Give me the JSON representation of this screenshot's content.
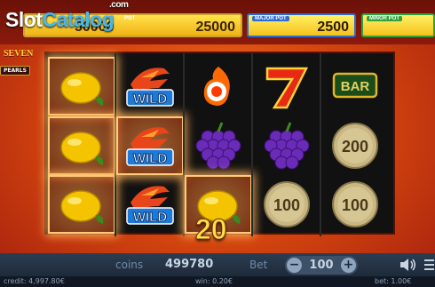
{
  "watermark": {
    "part_a": "Slot",
    "part_b": "Catalog",
    "com": ".com"
  },
  "jackpots": {
    "grand": {
      "label": "POT",
      "value": "50000"
    },
    "second": {
      "label": "POT",
      "value": "25000"
    },
    "major": {
      "label": "MAJOR POT",
      "value": "2500"
    },
    "minor": {
      "label": "MINOR POT",
      "value": ""
    }
  },
  "logo": {
    "title": "SEVEN",
    "subtitle": "PEARLS"
  },
  "reels": [
    [
      "lemon",
      "lemon",
      "lemon"
    ],
    [
      "wild",
      "wild",
      "wild"
    ],
    [
      "fire",
      "grapes",
      "lemon"
    ],
    [
      "seven",
      "grapes",
      "coin-100"
    ],
    [
      "bar",
      "coin-200",
      "coin-100"
    ]
  ],
  "win_cells": [
    [
      0,
      0
    ],
    [
      0,
      1
    ],
    [
      0,
      2
    ],
    [
      1,
      1
    ],
    [
      2,
      2
    ]
  ],
  "symbols": {
    "wild_label": "WILD",
    "bar_label": "BAR",
    "coin_100_label": "100",
    "coin_200_label": "200"
  },
  "win_amount": "20",
  "bottom_bar": {
    "coins_label": "coins",
    "coins_value": "499780",
    "bet_label": "Bet",
    "bet_value": "100",
    "minus": "−",
    "plus": "+"
  },
  "status": {
    "credit": "credit: 4,997.80€",
    "win": "win: 0.20€",
    "bet": "bet: 1.00€"
  },
  "colors": {
    "background": "#d8490f",
    "accent_gold": "#ffd23a",
    "win_glow": "#ffcb7a",
    "bar_bg": "#1d2a3a"
  }
}
